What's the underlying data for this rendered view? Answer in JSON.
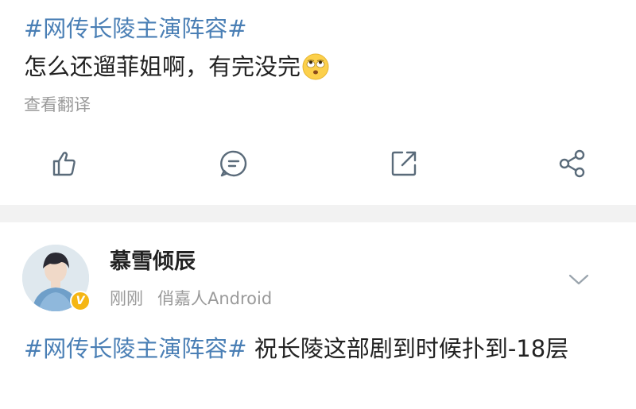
{
  "post1": {
    "hashtag": "#网传长陵主演阵容#",
    "text": "怎么还遛菲姐啊，有完没完",
    "emoji": "rolling-eyes-emoji",
    "translate_label": "查看翻译"
  },
  "actions": [
    {
      "icon": "like-icon"
    },
    {
      "icon": "comment-icon"
    },
    {
      "icon": "repost-icon"
    },
    {
      "icon": "share-icon"
    }
  ],
  "post2": {
    "username": "慕雪倾辰",
    "time": "刚刚",
    "device": "俏嘉人Android",
    "verified_badge": "V",
    "hashtag": "#网传长陵主演阵容#",
    "text": " 祝长陵这部剧到时候扑到-18层"
  },
  "colors": {
    "link": "#4a7fb5",
    "text": "#222222",
    "secondary": "#9a9a9a",
    "icon": "#5a6b7a",
    "divider": "#f2f2f2",
    "badge": "#f5b614"
  }
}
